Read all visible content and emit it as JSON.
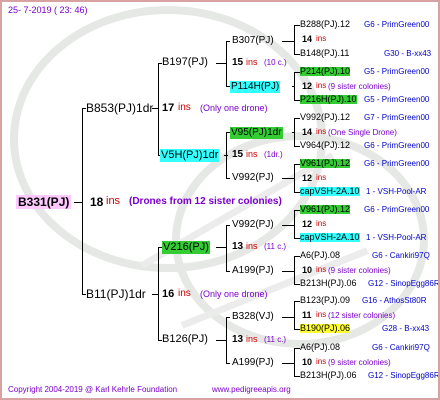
{
  "header": {
    "date": "25-  7-2019  ( 23: 46)"
  },
  "footer": {
    "copyright": "Copyright 2004-2019 @ Karl Kehrle Foundation",
    "website": "www.pedigreeapis.org"
  },
  "colors": {
    "root_highlight": "#ffc8ff",
    "green_highlight": "#33cc33",
    "cyan_highlight": "#33ffff",
    "yellow_highlight": "#ffff33",
    "ins_red": "#cc0000",
    "note_purple": "#7a00cc",
    "link_blue": "#0000cc",
    "frame_border": "#d9a2a2"
  },
  "root": {
    "name": "B331(PJ)",
    "ins": "18",
    "ins_label": "ins",
    "note": "(Drones from 12 sister colonies)"
  },
  "gen1": [
    {
      "name": "B853(PJ)1dr",
      "ins": "17",
      "ins_label": "ins",
      "note": "(Only one drone)"
    },
    {
      "name": "B11(PJ)1dr",
      "ins": "16",
      "ins_label": "ins",
      "note": "(Only one drone)"
    }
  ],
  "gen2": [
    {
      "name": "B197(PJ)",
      "ins": "15",
      "ins_label": "ins",
      "note": "(10 c.)"
    },
    {
      "name": "V5H(PJ)1dr",
      "ins": "15",
      "ins_label": "ins",
      "note": "(1dr.)"
    },
    {
      "name": "V216(PJ)",
      "ins": "13",
      "ins_label": "ins",
      "note": "(11 c.)"
    },
    {
      "name": "B126(PJ)",
      "ins": "13",
      "ins_label": "ins",
      "note": "(11 c.)"
    }
  ],
  "gen3": [
    {
      "name": "B307(PJ)",
      "ins": "14",
      "ins_label": "ins",
      "note": ""
    },
    {
      "name": "P114H(PJ)",
      "ins": "12",
      "ins_label": "ins",
      "note": "(9 sister colonies)"
    },
    {
      "name": "V95(PJ)1dr",
      "ins": "14",
      "ins_label": "ins",
      "note": "(One Single Drone)"
    },
    {
      "name": "V992(PJ)",
      "ins": "12",
      "ins_label": "ins",
      "note": ""
    },
    {
      "name": "V992(PJ)",
      "ins": "12",
      "ins_label": "ins",
      "note": ""
    },
    {
      "name": "A199(PJ)",
      "ins": "10",
      "ins_label": "ins",
      "note": "(9 sister colonies)"
    },
    {
      "name": "B328(VJ)",
      "ins": "11",
      "ins_label": "ins",
      "note": "(12 sister colonies)"
    },
    {
      "name": "A199(PJ)",
      "ins": "10",
      "ins_label": "ins",
      "note": "(9 sister colonies)"
    }
  ],
  "gen4": [
    {
      "name": "B288(PJ).12",
      "info": "G6 - PrimGreen00"
    },
    {
      "name": "B148(PJ).11",
      "info": "G30 - B-xx43"
    },
    {
      "name": "P214(PJ).10",
      "info": "G5 - PrimGreen00"
    },
    {
      "name": "P216H(PJ).10",
      "info": "G5 - PrimGreen00"
    },
    {
      "name": "V992(PJ).12",
      "info": "G7 - PrimGreen00"
    },
    {
      "name": "V964(PJ).12",
      "info": "G6 - PrimGreen00"
    },
    {
      "name": "V961(PJ).12",
      "info": "G6 - PrimGreen00"
    },
    {
      "name": "capVSH-2A.10",
      "info": "1 - VSH-Pool-AR"
    },
    {
      "name": "V961(PJ).12",
      "info": "G6 - PrimGreen00"
    },
    {
      "name": "capVSH-2A.10",
      "info": "1 - VSH-Pool-AR"
    },
    {
      "name": "A6(PJ).08",
      "info": "G6 - Cankiri97Q"
    },
    {
      "name": "B213H(PJ).06",
      "info": "G12 - SinopEgg86R"
    },
    {
      "name": "B123(PJ).09",
      "info": "G16 - AthosSt80R"
    },
    {
      "name": "B190(PJ).06",
      "info": "G28 - B-xx43"
    },
    {
      "name": "A6(PJ).08",
      "info": "G6 - Cankiri97Q"
    },
    {
      "name": "B213H(PJ).06",
      "info": "G12 - SinopEgg86R"
    }
  ]
}
